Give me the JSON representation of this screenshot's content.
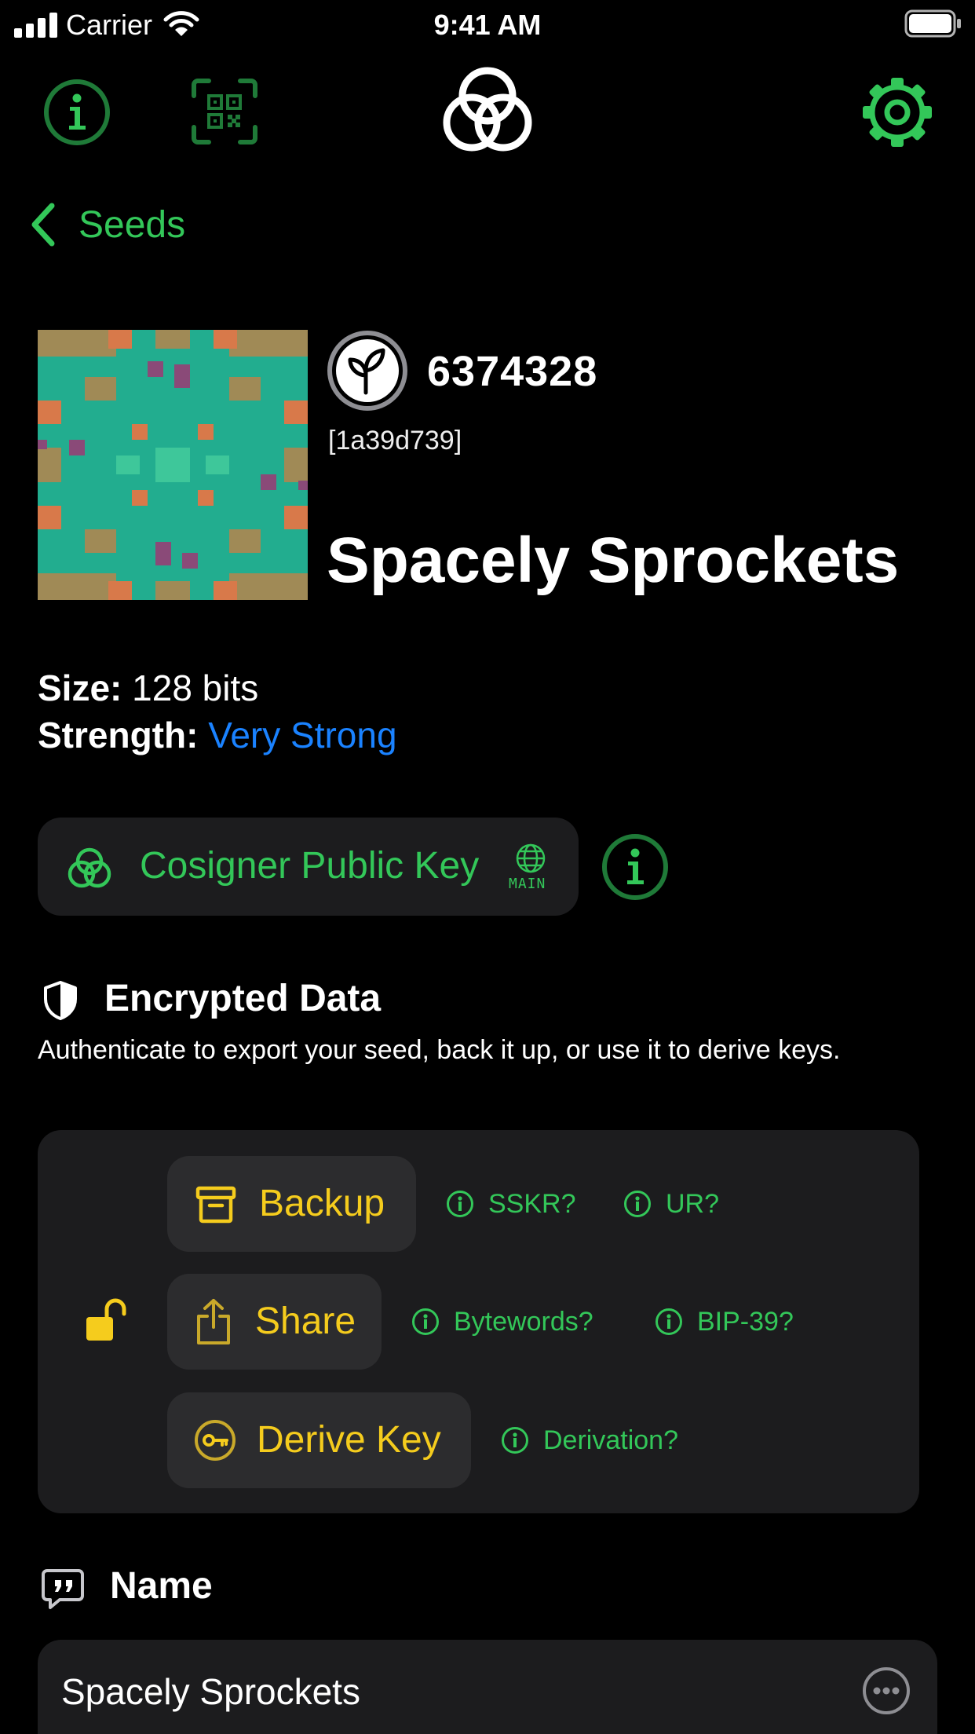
{
  "status_bar": {
    "carrier": "Carrier",
    "time": "9:41 AM"
  },
  "nav": {
    "back_label": "Seeds"
  },
  "seed": {
    "number": "6374328",
    "fingerprint": "[1a39d739]",
    "name": "Spacely Sprockets",
    "size_label": "Size:",
    "size_value": "128 bits",
    "strength_label": "Strength:",
    "strength_value": "Very Strong"
  },
  "cosigner": {
    "label": "Cosigner Public Key",
    "network_tag": "MAIN"
  },
  "encrypted": {
    "title": "Encrypted Data",
    "description": "Authenticate to export your seed, back it up, or use it to derive keys.",
    "backup_label": "Backup",
    "share_label": "Share",
    "derive_label": "Derive Key",
    "help": {
      "sskr": "SSKR?",
      "ur": "UR?",
      "bytewords": "Bytewords?",
      "bip39": "BIP-39?",
      "derivation": "Derivation?"
    }
  },
  "name_section": {
    "title": "Name",
    "value": "Spacely Sprockets"
  },
  "colors": {
    "accent_green": "#33c759",
    "accent_yellow": "#f5cc1d",
    "strength_blue": "#1a82ff",
    "card_bg": "#1c1c1e"
  }
}
